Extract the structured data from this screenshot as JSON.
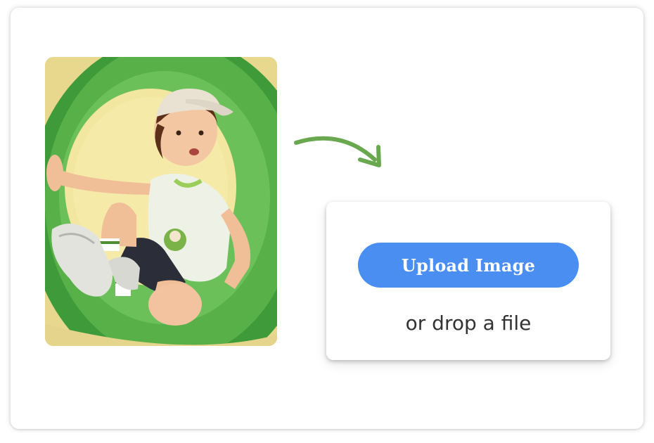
{
  "photo": {
    "alt": "Child in a cap sitting inside a green tube slide"
  },
  "arrow": {
    "icon": "curved-arrow-icon",
    "color": "#6aa84f"
  },
  "upload": {
    "button_label": "Upload Image",
    "drop_text": "or drop a file",
    "button_color": "#4a8ef2"
  }
}
